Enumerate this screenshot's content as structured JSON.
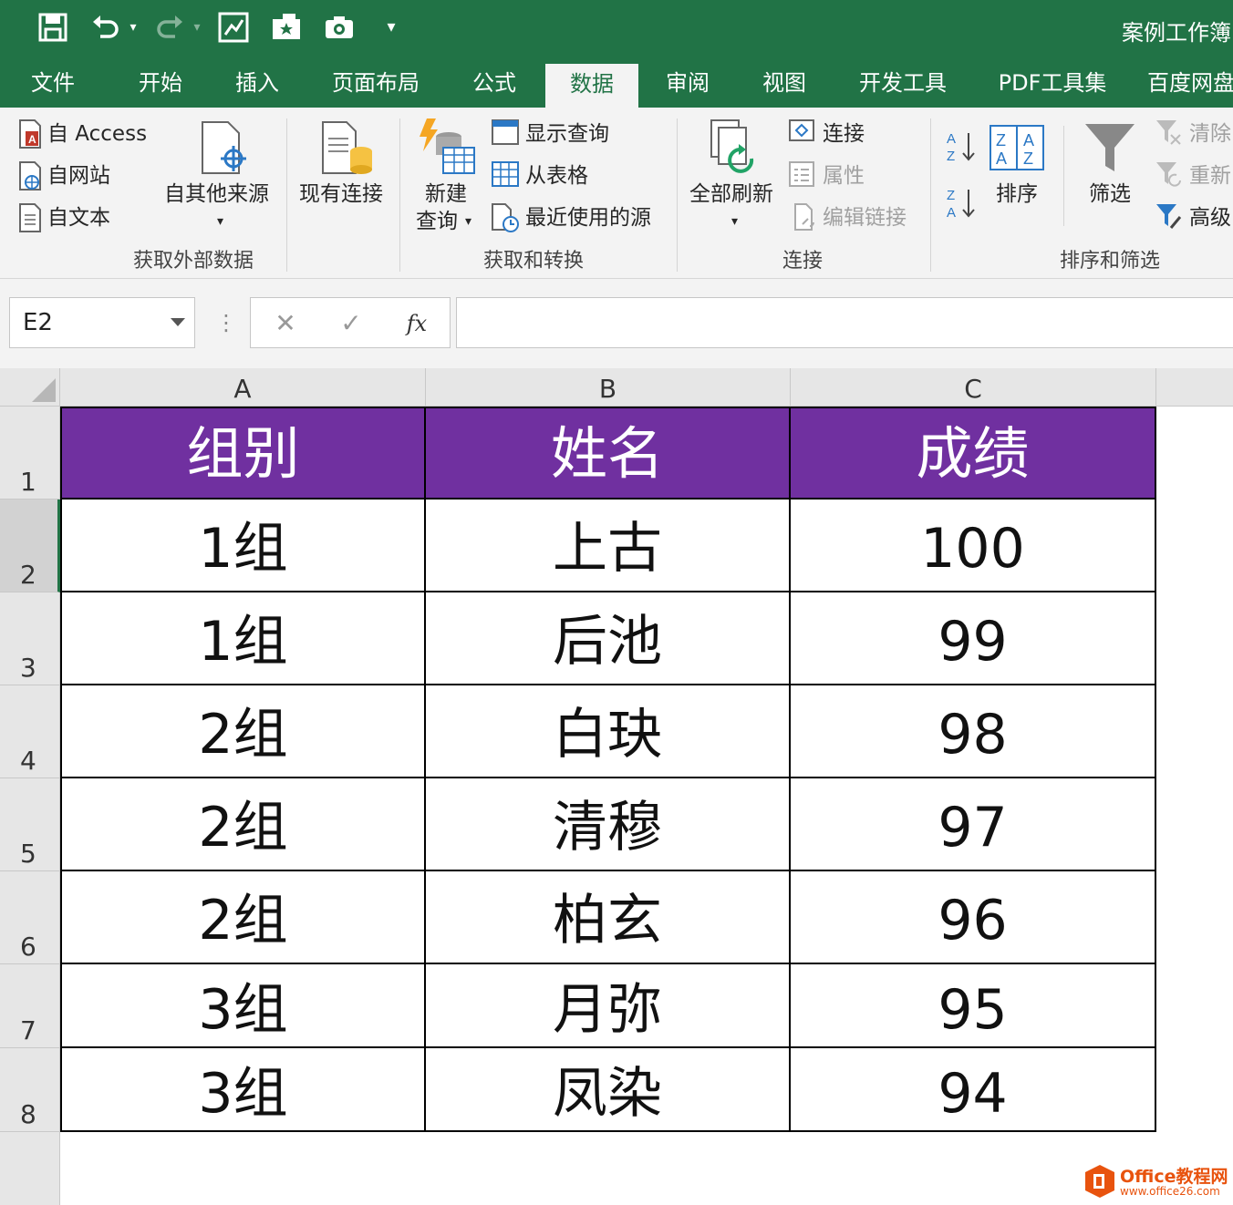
{
  "window": {
    "title": "案例工作簿"
  },
  "tabs": [
    "文件",
    "开始",
    "插入",
    "页面布局",
    "公式",
    "数据",
    "审阅",
    "视图",
    "开发工具",
    "PDF工具集",
    "百度网盘"
  ],
  "active_tab": "数据",
  "ribbon": {
    "get_external": {
      "access": "自 Access",
      "web": "自网站",
      "text": "自文本",
      "other": "自其他来源",
      "existing": "现有连接",
      "label": "获取外部数据"
    },
    "get_transform": {
      "new_query_1": "新建",
      "new_query_2": "查询",
      "show_queries": "显示查询",
      "from_table": "从表格",
      "recent_sources": "最近使用的源",
      "label": "获取和转换"
    },
    "connections": {
      "refresh_all": "全部刷新",
      "connections": "连接",
      "properties": "属性",
      "edit_links": "编辑链接",
      "label": "连接"
    },
    "sort_filter": {
      "sort": "排序",
      "filter": "筛选",
      "clear": "清除",
      "reapply": "重新",
      "advanced": "高级",
      "label": "排序和筛选"
    }
  },
  "formula_bar": {
    "name_box": "E2",
    "fx": "fx",
    "formula": ""
  },
  "columns": [
    "A",
    "B",
    "C"
  ],
  "rows": [
    "1",
    "2",
    "3",
    "4",
    "5",
    "6",
    "7",
    "8"
  ],
  "table": {
    "header": [
      "组别",
      "姓名",
      "成绩"
    ],
    "data": [
      [
        "1组",
        "上古",
        "100"
      ],
      [
        "1组",
        "后池",
        "99"
      ],
      [
        "2组",
        "白玦",
        "98"
      ],
      [
        "2组",
        "清穆",
        "97"
      ],
      [
        "2组",
        "柏玄",
        "96"
      ],
      [
        "3组",
        "月弥",
        "95"
      ],
      [
        "3组",
        "凤染",
        "94"
      ]
    ]
  },
  "watermark": {
    "brand": "Office教程网",
    "url": "www.office26.com"
  },
  "colors": {
    "accent": "#217346",
    "header_fill": "#7030a0"
  }
}
